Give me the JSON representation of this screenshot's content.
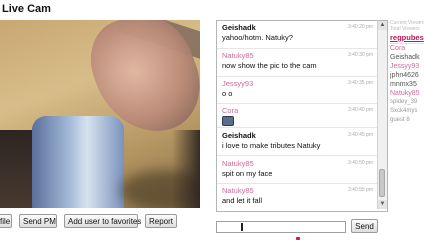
{
  "title": "Live Cam",
  "buttons": {
    "profile": "file",
    "send_pm": "Send PM",
    "add_favorites": "Add user to favorites",
    "report": "Report"
  },
  "chat": {
    "messages": [
      {
        "nick": "Geishadk",
        "role": "owner",
        "time": "3:40:20 pm",
        "text": "yahoo/hotm. Natuky?"
      },
      {
        "nick": "Natuky85",
        "role": "guest",
        "time": "3:40:30 pm",
        "text": "now show the pic to the cam"
      },
      {
        "nick": "Jessyy93",
        "role": "guest",
        "time": "3:40:35 pm",
        "text": "o   o"
      },
      {
        "nick": "Cora",
        "role": "guest",
        "time": "3:40:40 pm",
        "text": ""
      },
      {
        "nick": "Geishadk",
        "role": "owner",
        "time": "3:40:45 pm",
        "text": "i love to make tributes Natuky"
      },
      {
        "nick": "Natuky85",
        "role": "guest",
        "time": "3:40:50 pm",
        "text": "spit on my face"
      },
      {
        "nick": "Natuky85",
        "role": "guest",
        "time": "3:40:55 pm",
        "text": "and let it fall"
      }
    ]
  },
  "input": {
    "value": ""
  },
  "send_label": "Send",
  "users": {
    "ghost1": "Current Viewers",
    "ghost2": "Total Viewers",
    "highlight": "regpubes",
    "list": [
      {
        "name": "Cora",
        "style": "pink"
      },
      {
        "name": "Geishadk",
        "style": "gray"
      },
      {
        "name": "Jessyy93",
        "style": "pink"
      },
      {
        "name": "jphn4626",
        "style": "gray"
      },
      {
        "name": "mnmx35",
        "style": "gray"
      },
      {
        "name": "Natuky85",
        "style": "pink"
      },
      {
        "name": "spidey_39",
        "style": "faint"
      },
      {
        "name": "Sxck4mys",
        "style": "faint"
      },
      {
        "name": "guest 8",
        "style": "faint"
      }
    ]
  },
  "colors": {
    "guest_nick": "#d06a9a",
    "highlight_user": "#c0145c"
  }
}
